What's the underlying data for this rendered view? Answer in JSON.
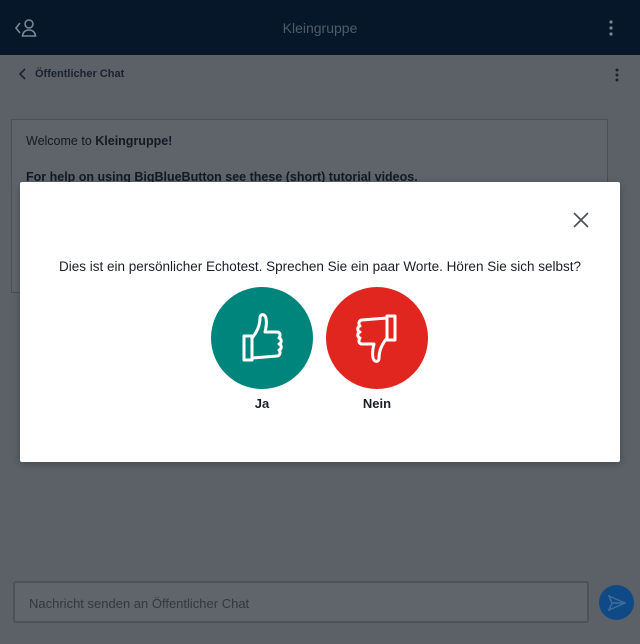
{
  "topbar": {
    "title": "Kleingruppe"
  },
  "chat": {
    "back_label": "Öffentlicher Chat",
    "welcome_prefix": "Welcome to ",
    "welcome_name": "Kleingruppe!",
    "help_text": "For help on using BigBlueButton see these (short) tutorial videos."
  },
  "composer": {
    "placeholder": "Nachricht senden an Öffentlicher Chat"
  },
  "modal": {
    "question": "Dies ist ein persönlicher Echotest. Sprechen Sie ein paar Worte. Hören Sie sich selbst?",
    "yes_label": "Ja",
    "no_label": "Nein"
  },
  "colors": {
    "topbar": "#06172a",
    "yes": "#00857d",
    "no": "#e0261f",
    "send": "#0f4a86"
  },
  "icons": [
    "user-icon",
    "kebab-icon",
    "chevron-left-icon",
    "close-icon",
    "thumbs-up-icon",
    "thumbs-down-icon",
    "send-icon"
  ]
}
